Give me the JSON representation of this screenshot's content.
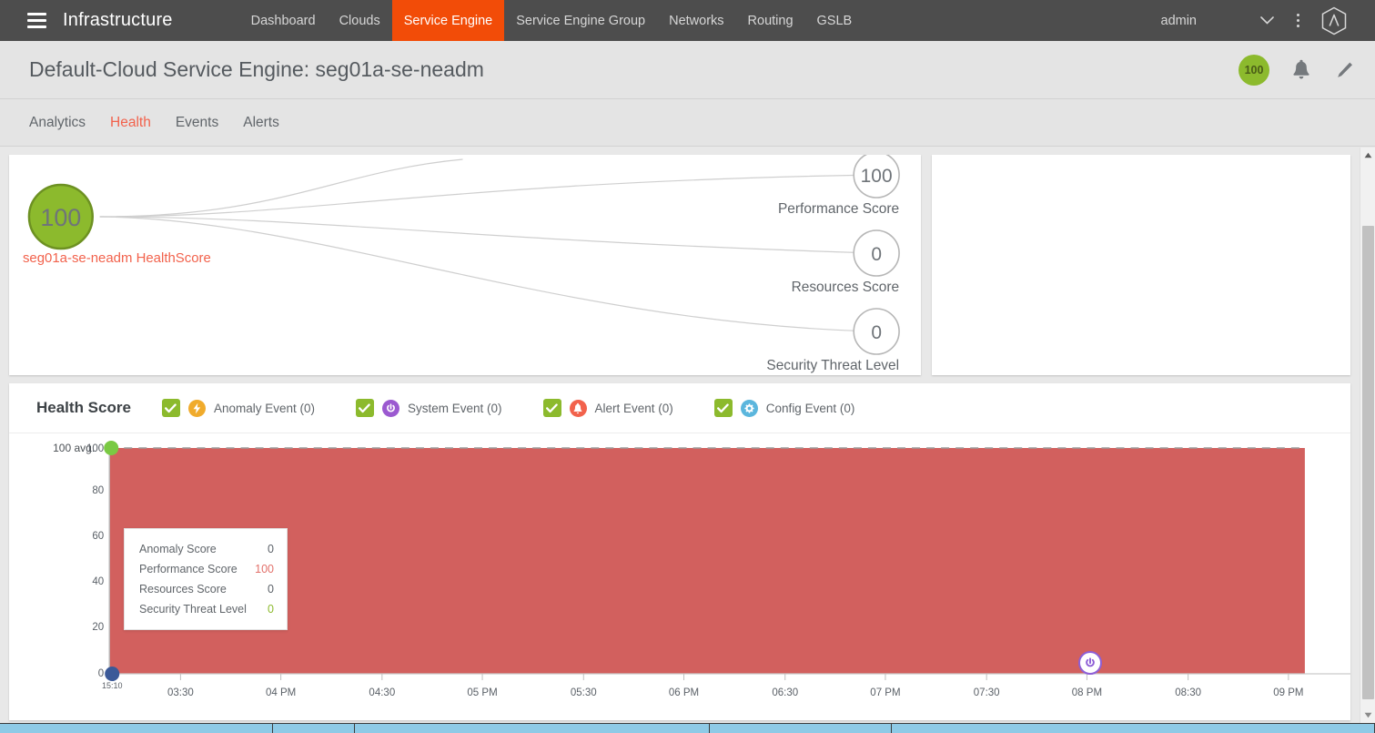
{
  "topnav": {
    "brand": "Infrastructure",
    "hamburger_icon": "hamburger-menu-icon",
    "menu": [
      {
        "label": "Dashboard",
        "active": false
      },
      {
        "label": "Clouds",
        "active": false
      },
      {
        "label": "Service Engine",
        "active": true
      },
      {
        "label": "Service Engine Group",
        "active": false
      },
      {
        "label": "Networks",
        "active": false
      },
      {
        "label": "Routing",
        "active": false
      },
      {
        "label": "GSLB",
        "active": false
      }
    ],
    "username": "admin",
    "caret_icon": "chevron-down-icon",
    "kebab_icon": "more-vertical-icon",
    "logo_icon": "avi-logo-icon",
    "bg": "#4d4d4d",
    "active_bg": "#f24c08"
  },
  "header": {
    "title": "Default-Cloud  Service Engine: seg01a-se-neadm",
    "score_badge": "100",
    "score_badge_color": "#8cba2d",
    "bell_icon": "notification-bell-icon",
    "edit_icon": "pencil-edit-icon"
  },
  "subtabs": [
    {
      "label": "Analytics",
      "active": false
    },
    {
      "label": "Health",
      "active": true
    },
    {
      "label": "Events",
      "active": false
    },
    {
      "label": "Alerts",
      "active": false
    }
  ],
  "tree": {
    "root": {
      "value": "100",
      "label": "seg01a-se-neadm HealthScore",
      "color": "#8cba2d"
    },
    "leaves": [
      {
        "value": "100",
        "label": "Performance Score"
      },
      {
        "value": "0",
        "label": "Resources Score"
      },
      {
        "value": "0",
        "label": "Security Threat Level"
      }
    ]
  },
  "chart_panel": {
    "title": "Health Score",
    "legend": [
      {
        "label": "Anomaly Event (0)",
        "checked": true,
        "icon": "anomaly-bolt-icon",
        "color": "#f0ab2c"
      },
      {
        "label": "System Event (0)",
        "checked": true,
        "icon": "system-power-icon",
        "color": "#9b59d0"
      },
      {
        "label": "Alert Event (0)",
        "checked": true,
        "icon": "alert-bell-icon",
        "color": "#f2624c"
      },
      {
        "label": "Config Event (0)",
        "checked": true,
        "icon": "config-gear-icon",
        "color": "#5bb6dd"
      }
    ]
  },
  "chart_data": {
    "type": "area",
    "title": "Health Score",
    "xlabel": "",
    "ylabel": "",
    "ylim": [
      0,
      100
    ],
    "yticks": [
      0,
      20,
      40,
      60,
      80,
      100
    ],
    "avg_text": "100 avg.",
    "start_tick": "15:10",
    "xticks": [
      "03:30",
      "04 PM",
      "04:30",
      "05 PM",
      "05:30",
      "06 PM",
      "06:30",
      "07 PM",
      "07:30",
      "08 PM",
      "08:30",
      "09 PM"
    ],
    "series": [
      {
        "name": "Health Score",
        "color": "#d2605e",
        "fill": "#d2605e",
        "value_constant": 100
      }
    ],
    "start_point_color": "#7ac943",
    "zero_point_color": "#3b5998",
    "markers": [
      {
        "type": "system-event",
        "x_label": "08 PM",
        "color": "#8e5fd6"
      }
    ]
  },
  "tooltip": {
    "rows": [
      {
        "name": "Anomaly Score",
        "value": "0",
        "color": "#5b6168"
      },
      {
        "name": "Performance Score",
        "value": "100",
        "color": "#e2706a"
      },
      {
        "name": "Resources Score",
        "value": "0",
        "color": "#5b6168"
      },
      {
        "name": "Security Threat Level",
        "value": "0",
        "color": "#8cba2d"
      }
    ]
  },
  "scrollbar": {
    "up_icon": "scroll-up-arrow-icon",
    "down_icon": "scroll-down-arrow-icon"
  }
}
